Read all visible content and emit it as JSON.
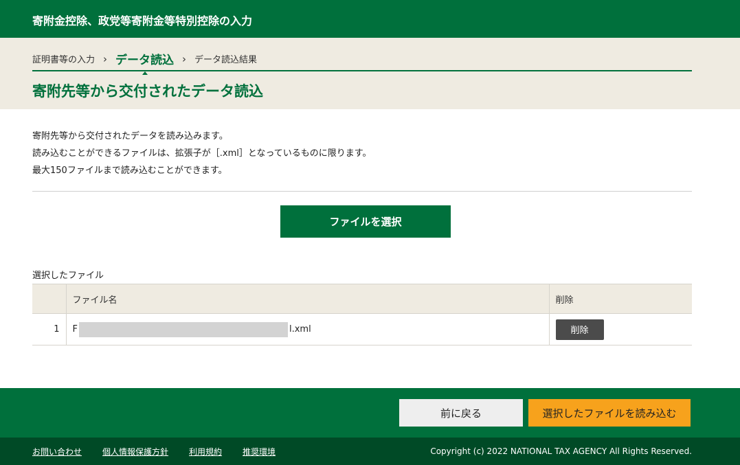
{
  "header": {
    "title": "寄附金控除、政党等寄附金等特別控除の入力"
  },
  "breadcrumb": {
    "items": [
      {
        "label": "証明書等の入力"
      },
      {
        "label": "データ読込"
      },
      {
        "label": "データ読込結果"
      }
    ],
    "separator": "›"
  },
  "page": {
    "title": "寄附先等から交付されたデータ読込"
  },
  "description": {
    "lines": [
      "寄附先等から交付されたデータを読み込みます。",
      "読み込むことができるファイルは、拡張子が［.xml］となっているものに限ります。",
      "最大150ファイルまで読み込むことができます。"
    ]
  },
  "select_button": {
    "label": "ファイルを選択"
  },
  "selected_files": {
    "label": "選択したファイル",
    "columns": [
      "",
      "ファイル名",
      "削除"
    ],
    "rows": [
      {
        "num": "1",
        "name_prefix": "F",
        "name_suffix": "l.xml",
        "delete_label": "削除"
      }
    ]
  },
  "actions": {
    "back_label": "前に戻る",
    "load_label": "選択したファイルを読み込む"
  },
  "footer": {
    "links": [
      {
        "label": "お問い合わせ"
      },
      {
        "label": "個人情報保護方針"
      },
      {
        "label": "利用規約"
      },
      {
        "label": "推奨環境"
      }
    ],
    "copyright": "Copyright (c) 2022 NATIONAL TAX AGENCY All Rights Reserved."
  },
  "colors": {
    "brand_green": "#00703c",
    "footer_dark_green": "#004a26",
    "beige": "#efebe1",
    "accent_orange": "#f7a21c",
    "delete_gray": "#4b4b4b"
  }
}
